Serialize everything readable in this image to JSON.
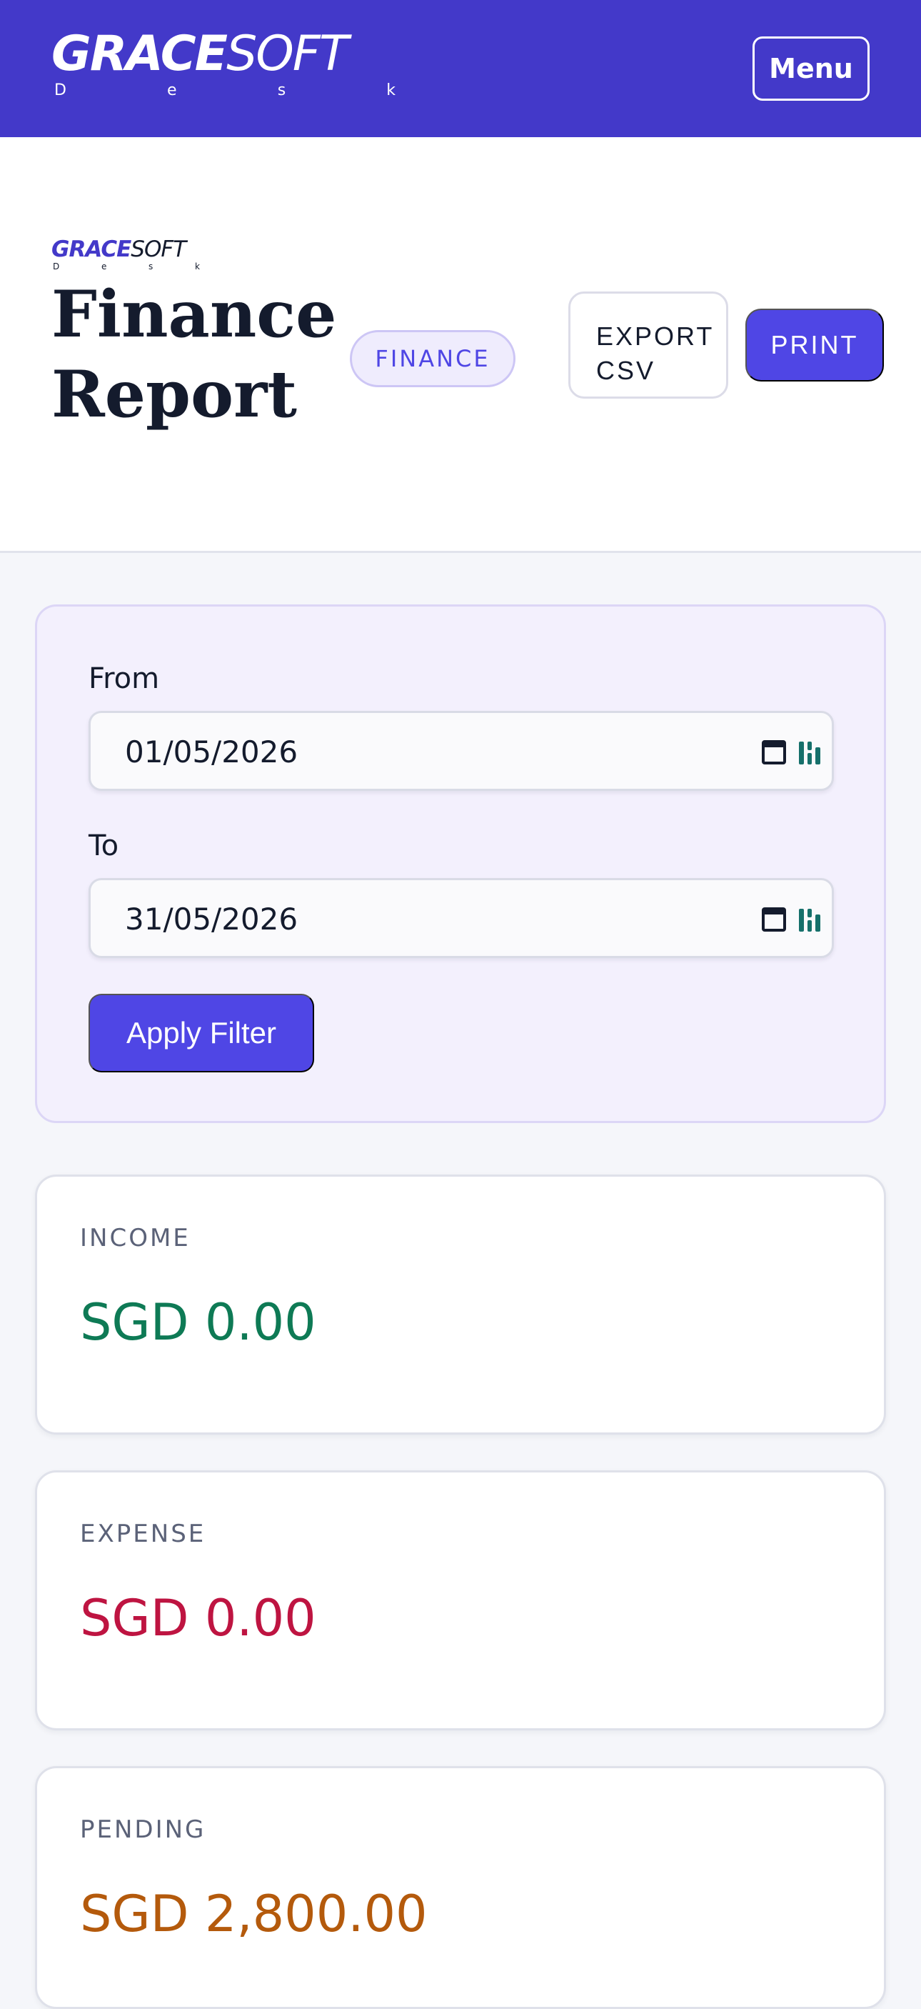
{
  "topbar": {
    "brand_bold": "GRACE",
    "brand_light": "SOFT",
    "brand_sub": [
      "D",
      "e",
      "s",
      "k"
    ],
    "menu_label": "Menu"
  },
  "header": {
    "mini_brand_bold": "GRACE",
    "mini_brand_light": "SOFT",
    "mini_brand_sub": [
      "D",
      "e",
      "s",
      "k"
    ],
    "title_line1": "Finance",
    "title_line2": "Report",
    "badge": "FINANCE",
    "export_line1": "EXPORT",
    "export_line2": "CSV",
    "print_label": "PRINT"
  },
  "filter": {
    "from_label": "From",
    "from_value": "01/05/2026",
    "to_label": "To",
    "to_value": "31/05/2026",
    "apply_label": "Apply Filter"
  },
  "stats": [
    {
      "label": "INCOME",
      "value": "SGD 0.00",
      "color": "#0e7a55"
    },
    {
      "label": "EXPENSE",
      "value": "SGD 0.00",
      "color": "#be1441"
    },
    {
      "label": "PENDING",
      "value": "SGD 2,800.00",
      "color": "#b45a0c"
    }
  ],
  "colors": {
    "brand": "#4339c9",
    "accent": "#4f46e5",
    "extension_icon": "#16706b"
  }
}
